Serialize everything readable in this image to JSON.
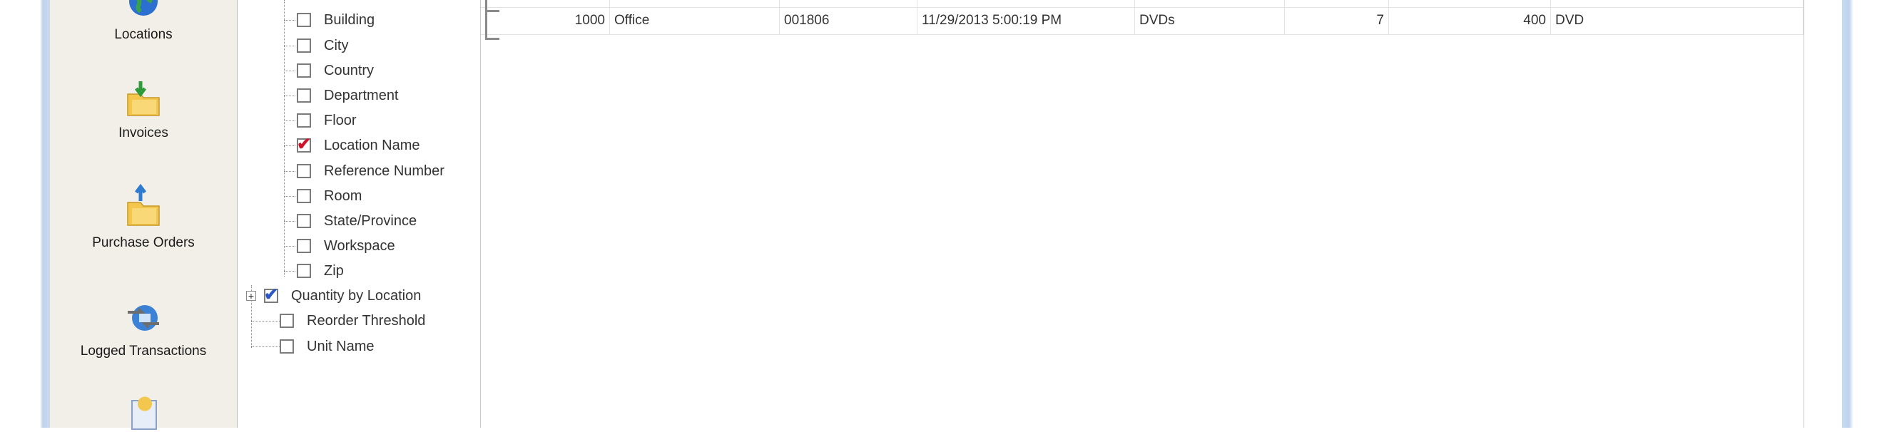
{
  "navigation": {
    "items": [
      {
        "label": "Locations",
        "icon": "globe-icon"
      },
      {
        "label": "Invoices",
        "icon": "invoice-folder-icon"
      },
      {
        "label": "Purchase Orders",
        "icon": "purchase-order-folder-icon"
      },
      {
        "label": "Logged Transactions",
        "icon": "transactions-icon"
      },
      {
        "label": "",
        "icon": "reports-icon"
      }
    ]
  },
  "tree": {
    "items": [
      {
        "label": "Building",
        "checked": false
      },
      {
        "label": "City",
        "checked": false
      },
      {
        "label": "Country",
        "checked": false
      },
      {
        "label": "Department",
        "checked": false
      },
      {
        "label": "Floor",
        "checked": false
      },
      {
        "label": "Location Name",
        "checked": true
      },
      {
        "label": "Reference Number",
        "checked": false
      },
      {
        "label": "Room",
        "checked": false
      },
      {
        "label": "State/Province",
        "checked": false
      },
      {
        "label": "Workspace",
        "checked": false
      },
      {
        "label": "Zip",
        "checked": false
      },
      {
        "label": "Quantity by Location",
        "checked": true
      },
      {
        "label": "Reorder Threshold",
        "checked": false
      },
      {
        "label": "Unit Name",
        "checked": false
      }
    ]
  },
  "grid": {
    "rows": [
      {
        "quantity": "1000",
        "location": "Office",
        "number": "001806",
        "date": "11/29/2013 5:00:19 PM",
        "category": "DVDs",
        "col6": "7",
        "col7": "400",
        "col8": "DVD"
      }
    ]
  },
  "colors": {
    "nav_background": "#f1efe7",
    "window_frame": "#c9daf0",
    "check_red": "#d1132a",
    "check_blue": "#2b55c8"
  }
}
